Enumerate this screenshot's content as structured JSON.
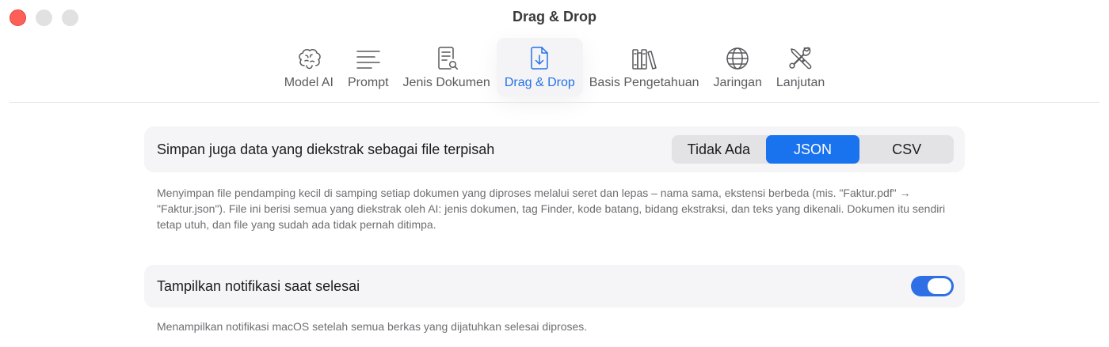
{
  "window": {
    "title": "Drag & Drop"
  },
  "toolbar": {
    "tabs": [
      {
        "label": "Model AI",
        "icon": "brain-icon"
      },
      {
        "label": "Prompt",
        "icon": "text-lines-icon"
      },
      {
        "label": "Jenis Dokumen",
        "icon": "document-search-icon"
      },
      {
        "label": "Drag & Drop",
        "icon": "document-download-icon",
        "active": true
      },
      {
        "label": "Basis Pengetahuan",
        "icon": "books-icon"
      },
      {
        "label": "Jaringan",
        "icon": "globe-icon"
      },
      {
        "label": "Lanjutan",
        "icon": "tools-icon"
      }
    ]
  },
  "settings": {
    "export": {
      "label": "Simpan juga data yang diekstrak sebagai file terpisah",
      "options": [
        "Tidak Ada",
        "JSON",
        "CSV"
      ],
      "selected": "JSON",
      "description": "Menyimpan file pendamping kecil di samping setiap dokumen yang diproses melalui seret dan lepas – nama sama, ekstensi berbeda (mis. \"Faktur.pdf\" → \"Faktur.json\"). File ini berisi semua yang diekstrak oleh AI: jenis dokumen, tag Finder, kode batang, bidang ekstraksi, dan teks yang dikenali. Dokumen itu sendiri tetap utuh, dan file yang sudah ada tidak pernah ditimpa."
    },
    "notification": {
      "label": "Tampilkan notifikasi saat selesai",
      "enabled": true,
      "description": "Menampilkan notifikasi macOS setelah semua berkas yang dijatuhkan selesai diproses."
    }
  },
  "colors": {
    "accent": "#1a73ee",
    "close_button": "#fe5f57"
  }
}
